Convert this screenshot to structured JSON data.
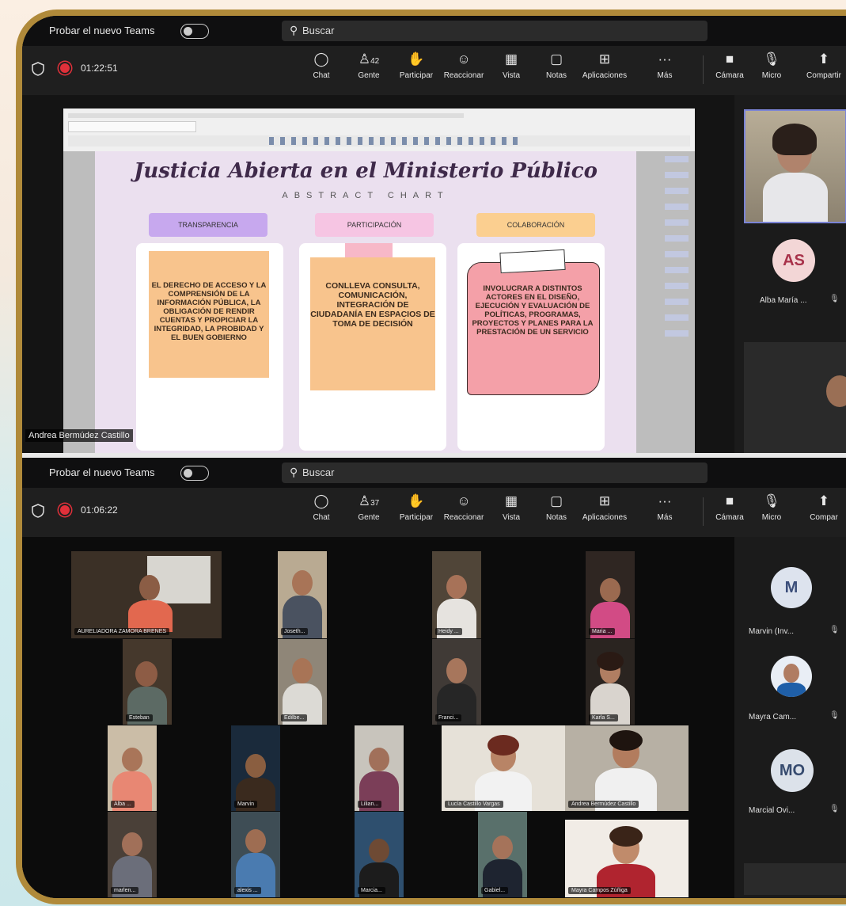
{
  "top_window": {
    "titlebar": {
      "label": "Probar el nuevo Teams",
      "search": "Buscar"
    },
    "timer": "01:22:51",
    "toolbar": {
      "chat": "Chat",
      "people": "Gente",
      "people_count": "42",
      "raise": "Participar",
      "react": "Reaccionar",
      "view": "Vista",
      "notes": "Notas",
      "apps": "Aplicaciones",
      "more": "Más",
      "camera": "Cámara",
      "mic": "Micro",
      "share": "Compartir"
    },
    "presenter_label": "Andrea Bermúdez Castillo",
    "slide": {
      "title": "Justicia Abierta en el Ministerio Público",
      "subtitle": "ABSTRACT CHART",
      "columns": [
        {
          "header": "TRANSPARENCIA",
          "text": "EL DERECHO DE ACCESO Y LA COMPRENSIÓN DE LA INFORMACIÓN PÚBLICA, LA OBLIGACIÓN DE RENDIR CUENTAS Y PROPICIAR LA INTEGRIDAD, LA PROBIDAD Y EL BUEN GOBIERNO"
        },
        {
          "header": "PARTICIPACIÓN",
          "text": "CONLLEVA CONSULTA, COMUNICACIÓN, INTEGRACIÓN DE CIUDADANÍA EN ESPACIOS DE TOMA DE DECISIÓN"
        },
        {
          "header": "COLABORACIÓN",
          "text": "INVOLUCRAR A DISTINTOS ACTORES EN EL DISEÑO, EJECUCIÓN Y EVALUACIÓN DE POLÍTICAS, PROGRAMAS, PROYECTOS Y PLANES PARA LA PRESTACIÓN DE UN SERVICIO"
        }
      ]
    },
    "side_participants": [
      {
        "initials": "AS",
        "name": "Alba María ..."
      }
    ]
  },
  "bottom_window": {
    "titlebar": {
      "label": "Probar el nuevo Teams",
      "search": "Buscar"
    },
    "timer": "01:06:22",
    "toolbar": {
      "chat": "Chat",
      "people": "Gente",
      "people_count": "37",
      "raise": "Participar",
      "react": "Reaccionar",
      "view": "Vista",
      "notes": "Notas",
      "apps": "Aplicaciones",
      "more": "Más",
      "camera": "Cámara",
      "mic": "Micro",
      "share": "Compar"
    },
    "video_labels": [
      "AURELIADORA ZAMORA BRENES",
      "Joseth...",
      "Heidy ...",
      "Maria ...",
      "Esteban",
      "Edilbe...",
      "Franci...",
      "Karla S...",
      "Alba ...",
      "Marvin",
      "Lilian...",
      "Lucía Castillo Vargas",
      "Andrea Bermúdez Castillo",
      "marlen...",
      "alexis ...",
      "Marcia...",
      "Gabiel...",
      "Mayra Campos Zúñiga"
    ],
    "side_participants": [
      {
        "initials": "M",
        "name": "Marvin (Inv..."
      },
      {
        "initials": "",
        "name": "Mayra Cam..."
      },
      {
        "initials": "MO",
        "name": "Marcial Ovi..."
      }
    ]
  },
  "colors": {
    "frame": "#b08a3a",
    "accent_record": "#e0303a",
    "avatar_bg": "#f3d6d6"
  }
}
